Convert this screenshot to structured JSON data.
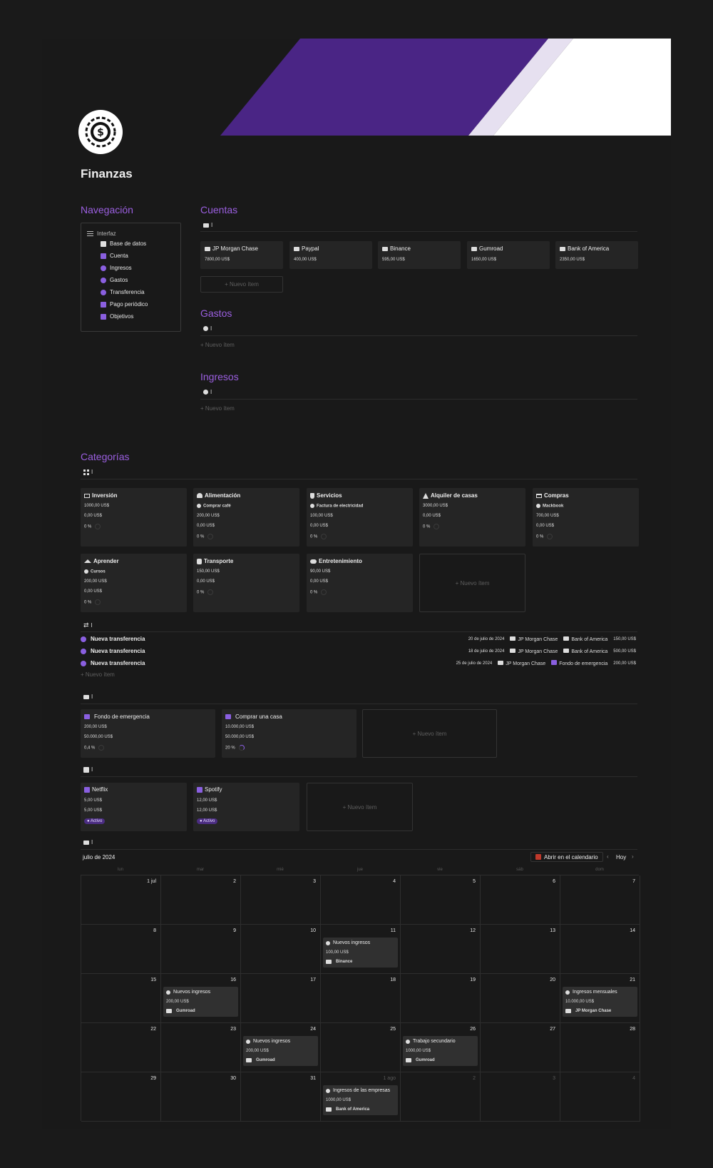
{
  "page": {
    "title": "Finanzas"
  },
  "nav": {
    "heading": "Navegación",
    "root": "Interfaz",
    "items": [
      "Base de datos",
      "Cuenta",
      "Ingresos",
      "Gastos",
      "Transferencia",
      "Pago periódico",
      "Objetivos"
    ]
  },
  "cuentas": {
    "heading": "Cuentas",
    "view_label": "I",
    "new_item": "Nuevo ítem",
    "accounts": [
      {
        "name": "JP Morgan Chase",
        "balance": "7800,00 US$"
      },
      {
        "name": "Paypal",
        "balance": "400,00 US$"
      },
      {
        "name": "Binance",
        "balance": "595,00 US$"
      },
      {
        "name": "Gumroad",
        "balance": "1650,00 US$"
      },
      {
        "name": "Bank of America",
        "balance": "2350,00 US$"
      }
    ]
  },
  "gastos": {
    "heading": "Gastos",
    "view_label": "I",
    "new_item": "Nuevo ítem"
  },
  "ingresos": {
    "heading": "Ingresos",
    "view_label": "I",
    "new_item": "Nuevo ítem"
  },
  "categorias": {
    "heading": "Categorías",
    "view_label": "I",
    "new_item": "Nuevo ítem",
    "items": [
      {
        "name": "Inversión",
        "sub": "",
        "budget": "1000,00 US$",
        "spent": "0,00 US$",
        "pct": "0 %"
      },
      {
        "name": "Alimentación",
        "sub": "Comprar café",
        "budget": "200,00 US$",
        "spent": "0,00 US$",
        "pct": "0 %"
      },
      {
        "name": "Servicios",
        "sub": "Factura de electricidad",
        "budget": "100,00 US$",
        "spent": "0,00 US$",
        "pct": "0 %"
      },
      {
        "name": "Alquiler de casas",
        "sub": "",
        "budget": "3000,00 US$",
        "spent": "0,00 US$",
        "pct": "0 %"
      },
      {
        "name": "Compras",
        "sub": "Mackbook",
        "budget": "700,00 US$",
        "spent": "0,00 US$",
        "pct": "0 %"
      },
      {
        "name": "Aprender",
        "sub": "Cursos",
        "budget": "200,00 US$",
        "spent": "0,00 US$",
        "pct": "0 %"
      },
      {
        "name": "Transporte",
        "sub": "",
        "budget": "150,00 US$",
        "spent": "0,00 US$",
        "pct": "0 %"
      },
      {
        "name": "Entretenimiento",
        "sub": "",
        "budget": "90,00 US$",
        "spent": "0,00 US$",
        "pct": "0 %"
      }
    ]
  },
  "transferencias": {
    "view_label": "I",
    "new_item": "Nuevo ítem",
    "rows": [
      {
        "name": "Nueva transferencia",
        "date": "20 de julio de 2024",
        "from": "JP Morgan Chase",
        "to": "Bank of America",
        "amount": "150,00 US$"
      },
      {
        "name": "Nueva transferencia",
        "date": "18 de julio de 2024",
        "from": "JP Morgan Chase",
        "to": "Bank of America",
        "amount": "500,00 US$"
      },
      {
        "name": "Nueva transferencia",
        "date": "25 de julio de 2024",
        "from": "JP Morgan Chase",
        "to": "Fondo de emergencia",
        "amount": "200,00 US$"
      }
    ]
  },
  "objetivos": {
    "view_label": "I",
    "new_item": "Nuevo ítem",
    "items": [
      {
        "name": "Fondo de emergencia",
        "saved": "200,00 US$",
        "target": "50.000,00 US$",
        "pct": "0,4 %"
      },
      {
        "name": "Comprar una casa",
        "saved": "10.000,00 US$",
        "target": "50.000,00 US$",
        "pct": "20 %"
      }
    ]
  },
  "pagos": {
    "view_label": "I",
    "new_item": "Nuevo ítem",
    "items": [
      {
        "name": "Netflix",
        "a": "5,00 US$",
        "b": "5,00 US$",
        "status": "Activo"
      },
      {
        "name": "Spotify",
        "a": "12,00 US$",
        "b": "12,00 US$",
        "status": "Activo"
      }
    ]
  },
  "calendar": {
    "view_label": "I",
    "month": "julio de 2024",
    "open_label": "Abrir en el calendario",
    "today": "Hoy",
    "weekdays": [
      "lun",
      "mar",
      "mié",
      "jue",
      "vie",
      "sáb",
      "dom"
    ],
    "days": [
      "1 jul",
      "2",
      "3",
      "4",
      "5",
      "6",
      "7",
      "8",
      "9",
      "10",
      "11",
      "12",
      "13",
      "14",
      "15",
      "16",
      "17",
      "18",
      "19",
      "20",
      "21",
      "22",
      "23",
      "24",
      "25",
      "26",
      "27",
      "28",
      "29",
      "30",
      "31",
      "1 ago",
      "2",
      "3",
      "4"
    ],
    "events": [
      {
        "title": "Nuevos ingresos",
        "amount": "100,00 US$",
        "account": "Binance"
      },
      {
        "title": "Nuevos ingresos",
        "amount": "200,00 US$",
        "account": "Gumroad"
      },
      {
        "title": "Ingresos mensuales",
        "amount": "10.000,00 US$",
        "account": "JP Morgan Chase"
      },
      {
        "title": "Nuevos ingresos",
        "amount": "200,00 US$",
        "account": "Gumroad"
      },
      {
        "title": "Trabajo secundario",
        "amount": "1000,00 US$",
        "account": "Gumroad"
      },
      {
        "title": "Ingresos de las empresas",
        "amount": "1000,00 US$",
        "account": "Bank of America"
      }
    ]
  },
  "colors": {
    "accent": "#9b5fe0",
    "cover_purple": "#4a2585",
    "cover_light": "#e6e0f0"
  }
}
